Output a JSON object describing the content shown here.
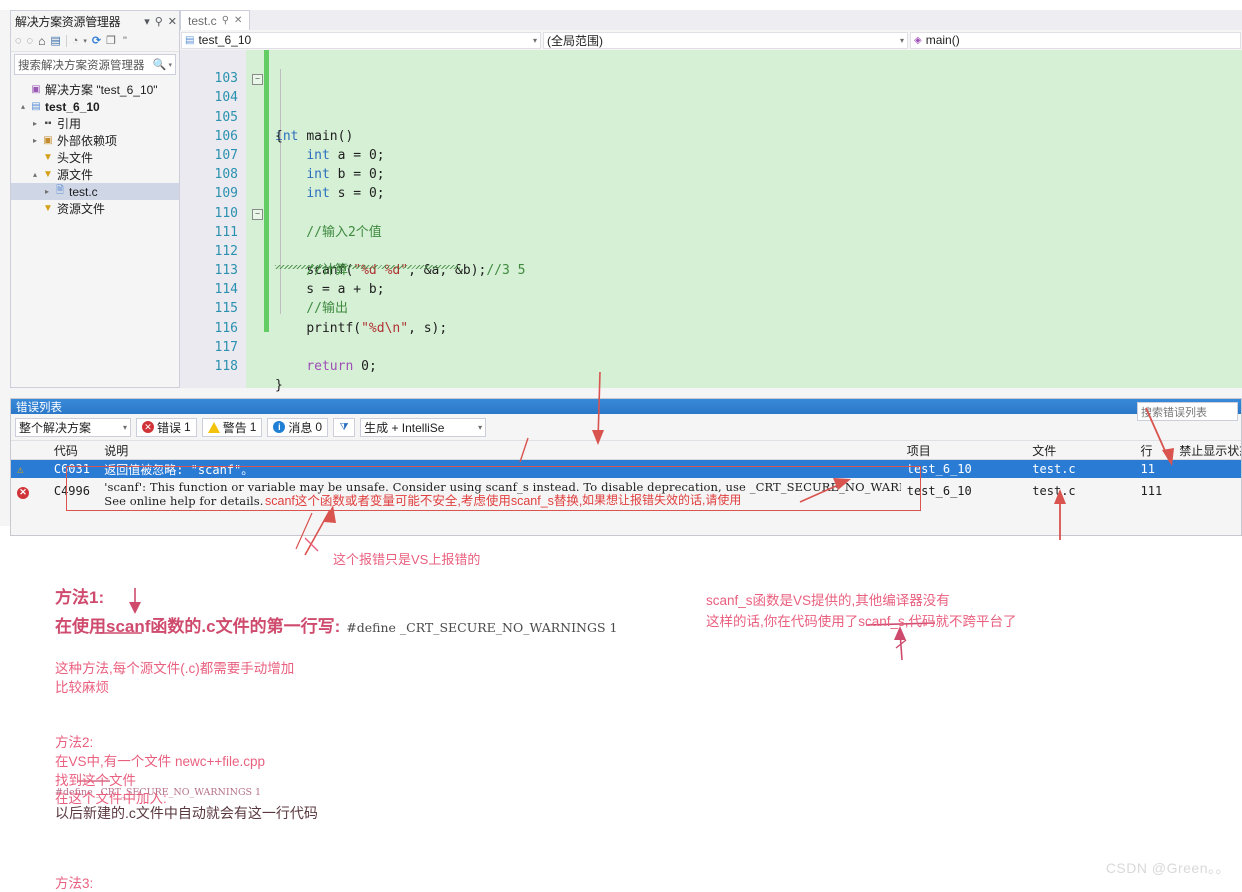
{
  "solution_explorer": {
    "title": "解决方案资源管理器",
    "header_icons": [
      "dropdown-icon",
      "pin-icon",
      "close-icon"
    ],
    "toolbar_icons": [
      "back-icon",
      "forward-icon",
      "home-icon",
      "show-all-files-icon",
      "view-icon",
      "refresh-icon",
      "properties-icon",
      "overflow-icon"
    ],
    "search_placeholder": "搜索解决方案资源管理器",
    "tree": [
      {
        "label": "解决方案 \"test_6_10\"",
        "icon": "solution-icon",
        "indent": 0,
        "twisty": "",
        "selected": false
      },
      {
        "label": "test_6_10",
        "icon": "project-icon",
        "indent": 0,
        "twisty": "▴",
        "selected": false
      },
      {
        "label": "引用",
        "icon": "references-icon",
        "indent": 1,
        "twisty": "▸",
        "selected": false
      },
      {
        "label": "外部依赖项",
        "icon": "external-dependencies-icon",
        "indent": 1,
        "twisty": "▸",
        "selected": false
      },
      {
        "label": "头文件",
        "icon": "folder-icon",
        "indent": 1,
        "twisty": "",
        "selected": false
      },
      {
        "label": "源文件",
        "icon": "folder-icon",
        "indent": 1,
        "twisty": "▴",
        "selected": false
      },
      {
        "label": "test.c",
        "icon": "c-file-icon",
        "indent": 2,
        "twisty": "▸",
        "selected": true
      },
      {
        "label": "资源文件",
        "icon": "folder-icon",
        "indent": 1,
        "twisty": "",
        "selected": false
      }
    ]
  },
  "editor": {
    "tab_label": "test.c",
    "nav_type": "test_6_10",
    "nav_scope": "(全局范围)",
    "nav_member": "main()",
    "first_line_number": 103,
    "lines": [
      {
        "n": 103,
        "code": "",
        "fold": ""
      },
      {
        "n": 104,
        "code": "int main()",
        "fold": "-"
      },
      {
        "n": 105,
        "code": "{",
        "fold": ""
      },
      {
        "n": 106,
        "code": "    int a = 0;",
        "fold": ""
      },
      {
        "n": 107,
        "code": "    int b = 0;",
        "fold": ""
      },
      {
        "n": 108,
        "code": "    int s = 0;",
        "fold": ""
      },
      {
        "n": 109,
        "code": "",
        "fold": ""
      },
      {
        "n": 110,
        "code": "    //输入2个值",
        "fold": ""
      },
      {
        "n": 111,
        "code": "    scanf(\"%d %d\", &a, &b);//3 5",
        "fold": "-"
      },
      {
        "n": 112,
        "code": "    //计算",
        "fold": ""
      },
      {
        "n": 113,
        "code": "    s = a + b;",
        "fold": ""
      },
      {
        "n": 114,
        "code": "    //输出",
        "fold": ""
      },
      {
        "n": 115,
        "code": "    printf(\"%d\\n\", s);",
        "fold": ""
      },
      {
        "n": 116,
        "code": "",
        "fold": ""
      },
      {
        "n": 117,
        "code": "    return 0;",
        "fold": ""
      },
      {
        "n": 118,
        "code": "}",
        "fold": ""
      }
    ]
  },
  "error_list": {
    "panel_title": "错误列表",
    "scope_filter": "整个解决方案",
    "errors_label": "错误",
    "errors_count": "1",
    "warnings_label": "警告",
    "warnings_count": "1",
    "messages_label": "消息",
    "messages_count": "0",
    "build_filter": "生成 + IntelliSe",
    "search_placeholder": "搜索错误列表",
    "columns": [
      "",
      "代码",
      "说明",
      "项目",
      "文件",
      "行",
      "禁止显示状态"
    ],
    "rows": [
      {
        "severity": "warning-icon",
        "code": "C6031",
        "description": "返回值被忽略:  \"scanf\"。",
        "project": "test_6_10",
        "file": "test.c",
        "line": "11",
        "suppression": ""
      },
      {
        "severity": "error-icon",
        "code": "C4996",
        "description_line1": "'scanf': This function or variable may be unsafe. Consider using scanf_s instead. To disable deprecation, use _CRT_SECURE_NO_WARNINGS.",
        "description_line2": "See online help for details.",
        "annotation_cn_1": "scanf这个函数或者变量可能不安全,考虑使用scanf_s替换,",
        "annotation_cn_2": "如果想让报错失效的话,请使用",
        "project": "test_6_10",
        "file": "test.c",
        "line": "111",
        "suppression": ""
      }
    ]
  },
  "annotations": {
    "note_vs_only": "这个报错只是VS上报错的",
    "method1_title": "方法1:",
    "method1_line": "在使用scanf函数的.c文件的第一行写:",
    "method1_code": "#define _CRT_SECURE_NO_WARNINGS 1",
    "method1_note1": "这种方法,每个源文件(.c)都需要手动增加",
    "method1_note2": "比较麻烦",
    "method2_title": "方法2:",
    "method2_line1": "在VS中,有一个文件 newc++file.cpp",
    "method2_line2": "找到这个文件",
    "method2_line3": "在这个文件中加入:",
    "method2_code": "#define _CRT_SECURE_NO_WARNINGS 1",
    "method2_line4": "以后新建的.c文件中自动就会有这一行代码",
    "method3_title": "方法3:",
    "right_note1": "scanf_s函数是VS提供的,其他编译器没有",
    "right_note2": "这样的话,你在代码使用了scanf_s,代码就不跨平台了"
  },
  "watermark": "CSDN @Green。。",
  "colors": {
    "accent_blue": "#2a7bd4",
    "error_red": "#d13438",
    "warning_yellow": "#f2c20c",
    "annotation_pink": "#e9607f",
    "annotation_red": "#e0403f",
    "code_bg_green": "#d6f0d6",
    "change_bar_green": "#63cc63"
  }
}
